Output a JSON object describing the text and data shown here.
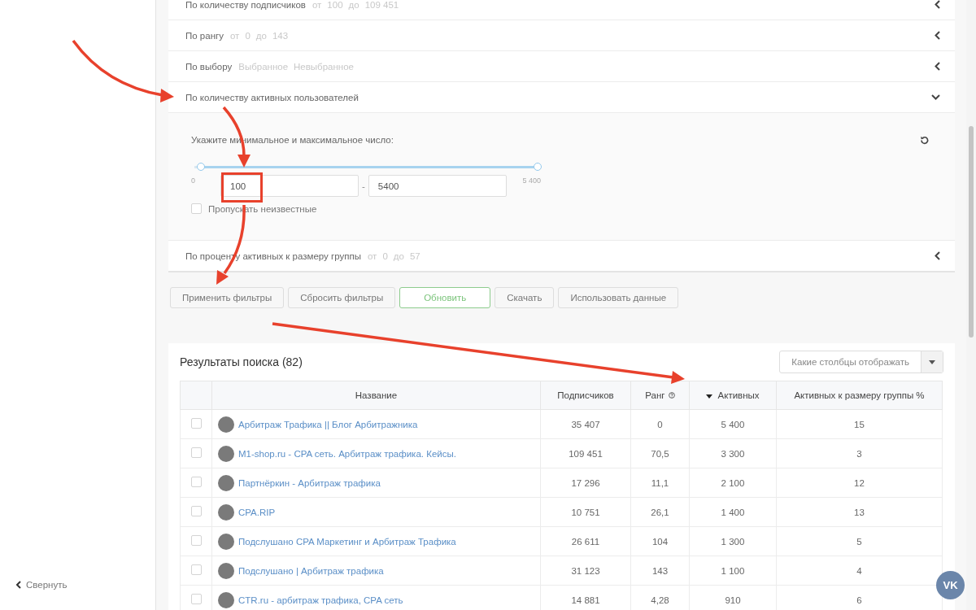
{
  "sidebar": {
    "collapse_label": "Свернуть"
  },
  "filters": [
    {
      "label": "По количеству подписчиков",
      "expanded": false,
      "hints": [
        "от",
        "100",
        "до",
        "109 451"
      ]
    },
    {
      "label": "По рангу",
      "expanded": false,
      "hints": [
        "от",
        "0",
        "до",
        "143"
      ]
    },
    {
      "label": "По выбору",
      "expanded": false,
      "hints": [
        "Выбранное",
        "Невыбранное"
      ]
    },
    {
      "label": "По количеству активных пользователей",
      "expanded": true
    },
    {
      "label": "По проценту активных к размеру группы",
      "expanded": false,
      "hints": [
        "от",
        "0",
        "до",
        "57"
      ]
    }
  ],
  "range_panel": {
    "prompt": "Укажите минимальное и максимальное число:",
    "min_label": "0",
    "max_label": "5 400",
    "thumbs": [
      {
        "level": 0.02
      },
      {
        "level": 1
      }
    ],
    "min_value": "100",
    "separator": "-",
    "max_value": "5400",
    "skip_unknown": {
      "label": "Пропускать неизвестные",
      "checked": false
    }
  },
  "buttons": [
    {
      "label": "Применить фильтры",
      "kind": "default"
    },
    {
      "label": "Сбросить фильтры",
      "kind": "default"
    },
    {
      "label": "Обновить",
      "kind": "success"
    },
    {
      "label": "Скачать",
      "kind": "default"
    },
    {
      "label": "Использовать данные",
      "kind": "default"
    }
  ],
  "results": {
    "title": "Результаты поиска (82)",
    "columns_picker": {
      "placeholder": "Какие столбцы отображать"
    },
    "columns": [
      {
        "label": "Название",
        "sorted": false,
        "help": false
      },
      {
        "label": "Подписчиков",
        "sorted": false,
        "help": false
      },
      {
        "label": "Ранг",
        "sorted": false,
        "help": true
      },
      {
        "label": "Активных",
        "sorted": true,
        "help": false
      },
      {
        "label": "Активных к размеру группы %",
        "sorted": false,
        "help": false
      }
    ],
    "rows": [
      {
        "checked": false,
        "name": "Арбитраж Трафика || Блог Арбитражника",
        "subscribers": "35 407",
        "rank": "0",
        "active": "5 400",
        "percent": "15"
      },
      {
        "checked": false,
        "name": "M1-shop.ru - CPA сеть. Арбитраж трафика. Кейсы.",
        "subscribers": "109 451",
        "rank": "70,5",
        "active": "3 300",
        "percent": "3"
      },
      {
        "checked": false,
        "name": "Партнёркин - Арбитраж трафика",
        "subscribers": "17 296",
        "rank": "11,1",
        "active": "2 100",
        "percent": "12"
      },
      {
        "checked": false,
        "name": "CPA.RIP",
        "subscribers": "10 751",
        "rank": "26,1",
        "active": "1 400",
        "percent": "13"
      },
      {
        "checked": false,
        "name": "Подслушано CPA Маркетинг и Арбитраж Трафика",
        "subscribers": "26 611",
        "rank": "104",
        "active": "1 300",
        "percent": "5"
      },
      {
        "checked": false,
        "name": "Подслушано | Арбитраж трафика",
        "subscribers": "31 123",
        "rank": "143",
        "active": "1 100",
        "percent": "4"
      },
      {
        "checked": false,
        "name": "CTR.ru - арбитраж трафика, CPA сеть",
        "subscribers": "14 881",
        "rank": "4,28",
        "active": "910",
        "percent": "6"
      }
    ]
  },
  "vk_button": {
    "label": "VK"
  }
}
